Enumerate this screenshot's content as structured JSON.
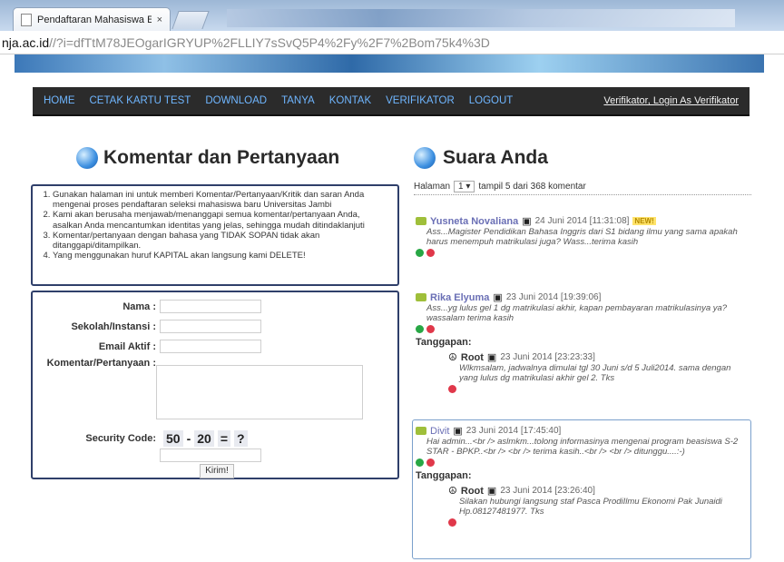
{
  "browser": {
    "tab_title": "Pendaftaran Mahasiswa E",
    "tab_close": "×",
    "url_host": "nja.ac.id",
    "url_rest": "//?i=dfTtM78JEOgarIGRYUP%2FLLIY7sSvQ5P4%2Fy%2F7%2Bom75k4%3D"
  },
  "nav": {
    "items": [
      "HOME",
      "CETAK KARTU TEST",
      "DOWNLOAD",
      "TANYA",
      "KONTAK",
      "VERIFIKATOR",
      "LOGOUT"
    ],
    "login_info": "Verifikator, Login As Verifikator"
  },
  "left": {
    "title": "Komentar dan Pertanyaan",
    "rules": [
      "Gunakan halaman ini untuk memberi Komentar/Pertanyaan/Kritik dan saran Anda mengenai proses pendaftaran seleksi mahasiswa baru Universitas Jambi",
      "Kami akan berusaha menjawab/menanggapi semua komentar/pertanyaan Anda, asalkan Anda mencantumkan identitas yang jelas, sehingga mudah ditindaklanjuti",
      "Komentar/pertanyaan dengan bahasa yang TIDAK SOPAN tidak akan ditanggapi/ditampilkan.",
      "Yang menggunakan huruf KAPITAL akan langsung kami DELETE!"
    ],
    "form": {
      "nama_label": "Nama :",
      "sekolah_label": "Sekolah/Instansi :",
      "email_label": "Email Aktif :",
      "komentar_label": "Komentar/Pertanyaan :",
      "security_label": "Security Code:",
      "sec_a": "50",
      "sec_op": "-",
      "sec_b": "20",
      "sec_eq": "=",
      "sec_q": "?",
      "submit": "Kirim!"
    }
  },
  "right": {
    "title": "Suara Anda",
    "pager_prefix": "Halaman",
    "pager_value": "1",
    "pager_suffix": "tampil 5 dari 368 komentar",
    "comments": [
      {
        "name": "Yusneta Novaliana",
        "date": "24 Juni 2014 [11:31:08]",
        "badge": "NEW!",
        "body": "Ass...Magister Pendidikan Bahasa Inggris dari S1 bidang ilmu yang sama apakah harus menempuh matrikulasi juga? Wass...terima kasih"
      },
      {
        "name": "Rika Elyuma",
        "date": "23 Juni 2014 [19:39:06]",
        "body": "Ass...yg lulus gel 1 dg matrikulasi akhir, kapan pembayaran matrikulasinya ya? wassalam terima kasih",
        "reply_label": "Tanggapan:",
        "reply_name": "Root",
        "reply_date": "23 Juni 2014 [23:23:33]",
        "reply_body": "Wlkmsalam, jadwalnya dimulai tgl 30 Juni s/d 5 Juli2014. sama dengan yang lulus dg matrikulasi akhir gel 2. Tks"
      },
      {
        "name": "Divit",
        "date": "23 Juni 2014 [17:45:40]",
        "body": "Hai admin...<br /> aslmkm...tolong informasinya mengenai program beasiswa S-2 STAR - BPKP..<br /> <br /> terima kasih..<br /> <br /> ditunggu....:-)",
        "reply_label": "Tanggapan:",
        "reply_name": "Root",
        "reply_date": "23 Juni 2014 [23:26:40]",
        "reply_body": "Silakan hubungi langsung staf Pasca ProdiIlmu Ekonomi Pak Junaidi Hp.08127481977. Tks"
      }
    ]
  },
  "colors": {
    "nav_bg": "#2b2b2b",
    "nav_link": "#6fb6ff",
    "box_border": "#2f3f6a",
    "vote_up": "#28a745",
    "vote_down": "#e0384a"
  }
}
